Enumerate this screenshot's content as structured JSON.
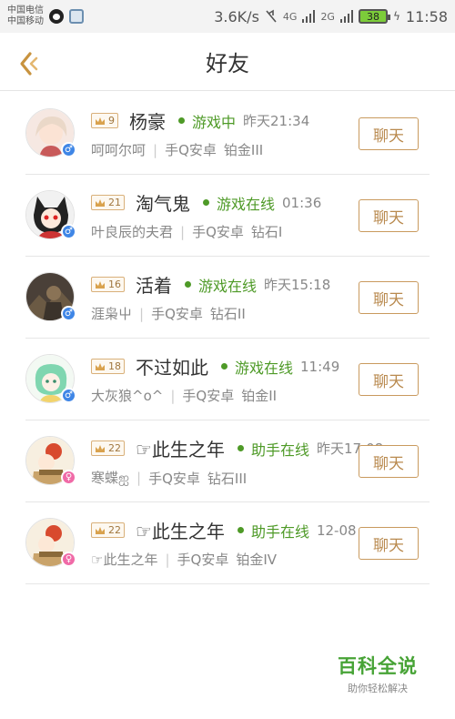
{
  "status_bar": {
    "carrier1": "中国电信",
    "carrier2": "中国移动",
    "speed": "3.6K/s",
    "network1": "4G",
    "network2": "2G",
    "battery": "38",
    "time": "11:58"
  },
  "header": {
    "title": "好友",
    "accent": "#c8933f"
  },
  "friends": [
    {
      "level": "9",
      "name": "杨豪",
      "status": "游戏中",
      "time": "昨天21:34",
      "signature": "呵呵尔呵",
      "platform": "手Q安卓",
      "rank": "铂金III",
      "gender": "♂",
      "chat_label": "聊天"
    },
    {
      "level": "21",
      "name": "淘气鬼",
      "status": "游戏在线",
      "time": "01:36",
      "signature": "叶良辰的夫君",
      "platform": "手Q安卓",
      "rank": "钻石I",
      "gender": "♂",
      "chat_label": "聊天"
    },
    {
      "level": "16",
      "name": "活着",
      "status": "游戏在线",
      "time": "昨天15:18",
      "signature": "涯枭屮",
      "platform": "手Q安卓",
      "rank": "钻石II",
      "gender": "♂",
      "chat_label": "聊天"
    },
    {
      "level": "18",
      "name": "不过如此",
      "status": "游戏在线",
      "time": "11:49",
      "signature": "大灰狼^o^",
      "platform": "手Q安卓",
      "rank": "铂金II",
      "gender": "♂",
      "chat_label": "聊天"
    },
    {
      "level": "22",
      "name": "☞此生之年",
      "status": "助手在线",
      "time": "昨天17:08",
      "signature": "寒蝶ஐ",
      "platform": "手Q安卓",
      "rank": "钻石III",
      "gender": "♀",
      "chat_label": "聊天"
    },
    {
      "level": "22",
      "name": "☞此生之年",
      "status": "助手在线",
      "time": "12-08",
      "signature": "☞此生之年",
      "platform": "手Q安卓",
      "rank": "铂金IV",
      "gender": "♀",
      "chat_label": "聊天"
    }
  ],
  "watermark": {
    "logo": "百科全说",
    "slogan": "助你轻松解决"
  }
}
